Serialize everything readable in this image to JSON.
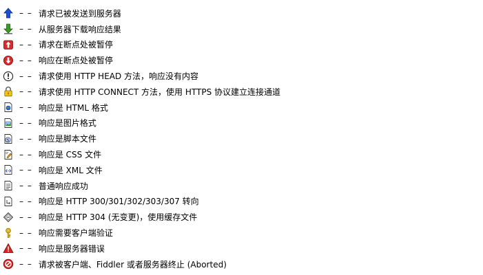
{
  "separator": "– –",
  "items": [
    {
      "icon": "blue-up-arrow-icon",
      "text": "请求已被发送到服务器"
    },
    {
      "icon": "green-down-arrow-icon",
      "text": "从服务器下载响应结果"
    },
    {
      "icon": "red-request-breakpoint-icon",
      "text": "请求在断点处被暂停"
    },
    {
      "icon": "red-response-breakpoint-icon",
      "text": "响应在断点处被暂停"
    },
    {
      "icon": "info-head-icon",
      "text": "请求使用 HTTP HEAD 方法，响应没有内容"
    },
    {
      "icon": "lock-icon",
      "text": "请求使用 HTTP CONNECT 方法，使用 HTTPS 协议建立连接通道"
    },
    {
      "icon": "html-document-icon",
      "text": "响应是 HTML 格式"
    },
    {
      "icon": "image-document-icon",
      "text": "响应是图片格式"
    },
    {
      "icon": "script-document-icon",
      "text": "响应是脚本文件"
    },
    {
      "icon": "css-document-icon",
      "text": "响应是 CSS 文件"
    },
    {
      "icon": "xml-document-icon",
      "text": "响应是 XML 文件"
    },
    {
      "icon": "plain-document-icon",
      "text": "普通响应成功"
    },
    {
      "icon": "redirect-document-icon",
      "text": "响应是 HTTP 300/301/302/303/307 转向"
    },
    {
      "icon": "cache-diamond-icon",
      "text": "响应是 HTTP 304 (无变更)，使用缓存文件"
    },
    {
      "icon": "key-icon",
      "text": "响应需要客户端验证"
    },
    {
      "icon": "warning-triangle-icon",
      "text": "响应是服务器错误"
    },
    {
      "icon": "aborted-circle-icon",
      "text": "请求被客户端、Fiddler 或者服务器终止 (Aborted)"
    }
  ]
}
